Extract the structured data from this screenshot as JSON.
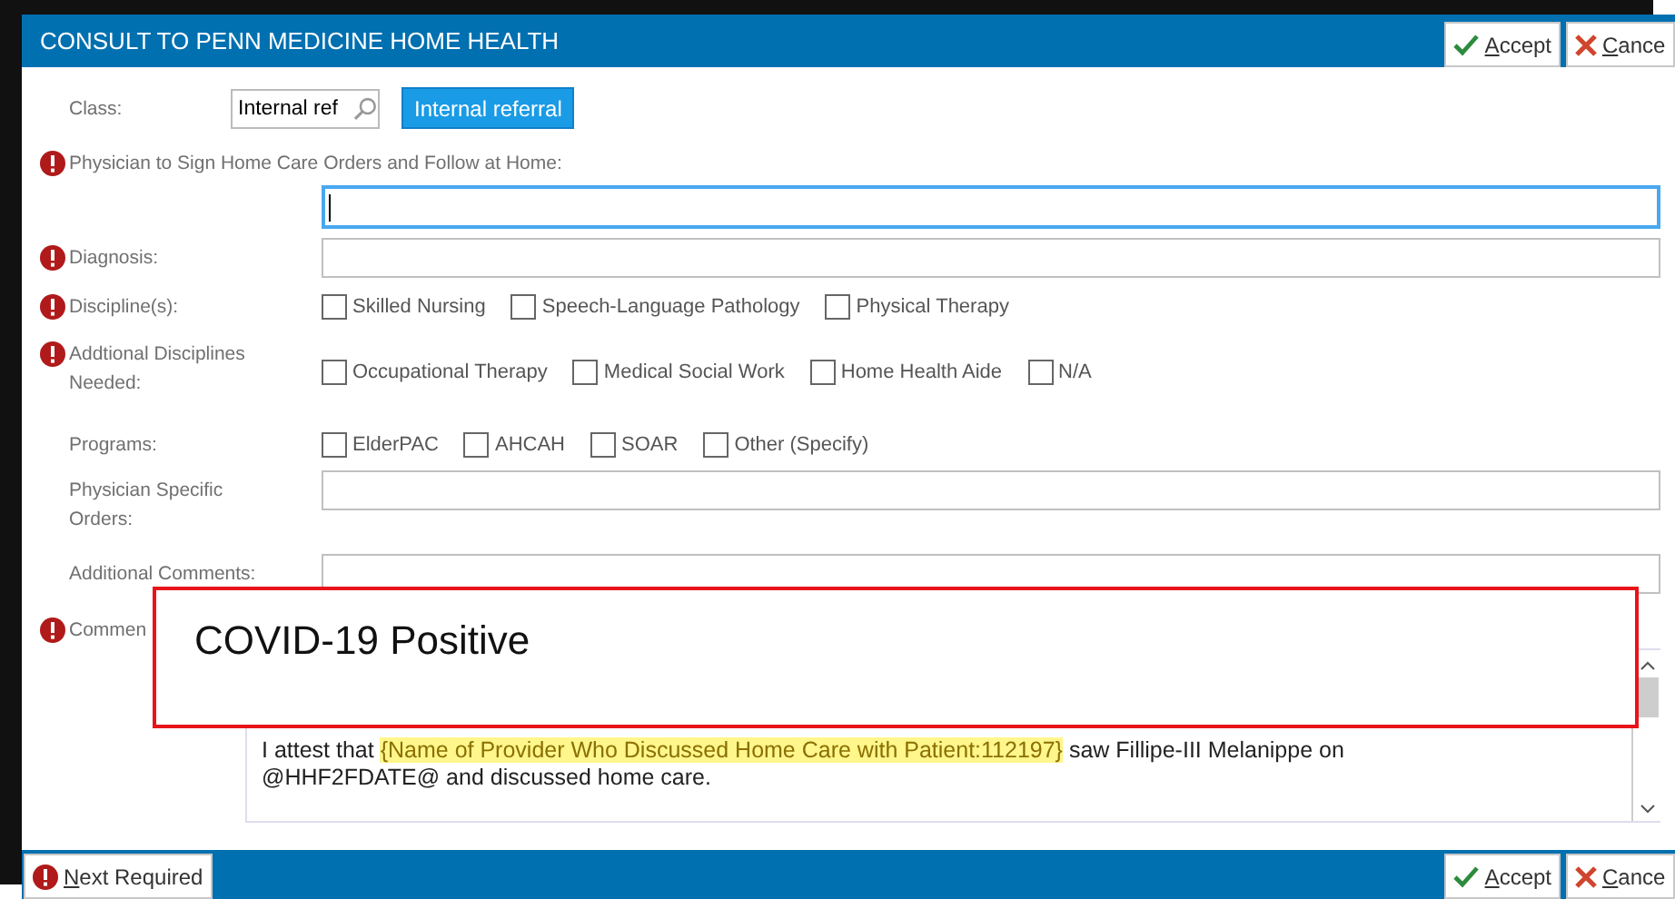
{
  "window": {
    "title": "CONSULT TO PENN MEDICINE HOME HEALTH",
    "buttons": [
      {
        "label": "Accept",
        "kind": "accept"
      },
      {
        "label": "Cance",
        "kind": "cancel"
      }
    ]
  },
  "class_row": {
    "label": "Class:",
    "value": "Internal ref",
    "button": "Internal referral"
  },
  "rows": [
    {
      "kind": "stacked",
      "label": "Physician to Sign Home Care Orders and Follow at Home:",
      "required": true,
      "focused": true
    },
    {
      "kind": "text",
      "label": "Diagnosis:",
      "required": true,
      "focused": false
    },
    {
      "kind": "checks",
      "label": "Discipline(s):",
      "required": true,
      "options": [
        {
          "label": "Skilled Nursing",
          "checked": false
        },
        {
          "label": "Speech-Language Pathology",
          "checked": false
        },
        {
          "label": "Physical Therapy",
          "checked": false
        }
      ]
    },
    {
      "kind": "checks",
      "label": "Addtional Disciplines Needed:",
      "required": true,
      "options": [
        {
          "label": "Occupational Therapy",
          "checked": false
        },
        {
          "label": "Medical Social Work",
          "checked": false
        },
        {
          "label": "Home Health Aide",
          "checked": false
        },
        {
          "label": "N/A",
          "checked": false
        }
      ]
    },
    {
      "kind": "checks",
      "label": "Programs:",
      "required": false,
      "options": [
        {
          "label": "ElderPAC",
          "checked": false
        },
        {
          "label": "AHCAH",
          "checked": false
        },
        {
          "label": "SOAR",
          "checked": false
        },
        {
          "label": "Other (Specify)",
          "checked": false
        }
      ]
    },
    {
      "kind": "text",
      "label": "Physician Specific Orders:",
      "required": false,
      "focused": false
    },
    {
      "kind": "text",
      "label": "Additional Comments:",
      "required": false,
      "focused": false
    }
  ],
  "comments": {
    "label": "Commen",
    "required": true,
    "lines": [
      [
        {
          "text": "I attest that ",
          "highlight": false
        },
        {
          "text": "{Name of Provider Who Discussed Home Care with Patient:112197}",
          "highlight": true
        },
        {
          "text": " saw Fillipe-III Melanippe on",
          "highlight": false
        }
      ],
      [
        {
          "text": "@HHF2FDATE@ and discussed home care.",
          "highlight": false
        }
      ]
    ]
  },
  "callout": {
    "text": "COVID-19 Positive"
  },
  "footer": {
    "next_button": "Next Required",
    "buttons": [
      {
        "label": "Accept",
        "kind": "accept"
      },
      {
        "label": "Cance",
        "kind": "cancel"
      }
    ]
  }
}
